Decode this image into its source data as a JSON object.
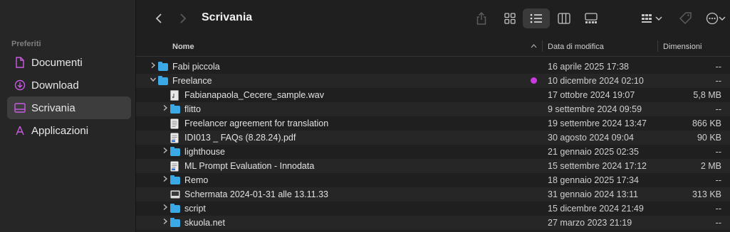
{
  "sidebar": {
    "header": "Preferiti",
    "items": [
      {
        "label": "Documenti",
        "icon": "document-icon",
        "selected": false
      },
      {
        "label": "Download",
        "icon": "download-icon",
        "selected": false
      },
      {
        "label": "Scrivania",
        "icon": "desktop-icon",
        "selected": true
      },
      {
        "label": "Applicazioni",
        "icon": "applications-icon",
        "selected": false
      }
    ]
  },
  "toolbar": {
    "title": "Scrivania",
    "active_view": "list"
  },
  "columns": {
    "name": "Nome",
    "date": "Data di modifica",
    "size": "Dimensioni"
  },
  "files": [
    {
      "name": "Fabi piccola",
      "date": "16 aprile 2025 17:38",
      "size": "--",
      "type": "folder",
      "level": 0,
      "expanded": false
    },
    {
      "name": "Freelance",
      "date": "10 dicembre 2024 02:10",
      "size": "--",
      "type": "folder",
      "level": 0,
      "expanded": true,
      "tag_color": "#c93bdf"
    },
    {
      "name": "Fabianapaola_Cecere_sample.wav",
      "date": "17 ottobre 2024 19:07",
      "size": "5,8 MB",
      "type": "audio",
      "level": 1
    },
    {
      "name": "flitto",
      "date": "9 settembre 2024 09:59",
      "size": "--",
      "type": "folder",
      "level": 1,
      "expanded": false
    },
    {
      "name": "Freelancer agreement for translation",
      "date": "19 settembre 2024 13:47",
      "size": "866 KB",
      "type": "document",
      "level": 1
    },
    {
      "name": "IDI013 _ FAQs (8.28.24).pdf",
      "date": "30 agosto 2024 09:04",
      "size": "90 KB",
      "type": "pdf",
      "level": 1
    },
    {
      "name": "lighthouse",
      "date": "21 gennaio 2025 02:35",
      "size": "--",
      "type": "folder",
      "level": 1,
      "expanded": false
    },
    {
      "name": "ML Prompt Evaluation - Innodata",
      "date": "15 settembre 2024 17:12",
      "size": "2 MB",
      "type": "pdf",
      "level": 1
    },
    {
      "name": "Remo",
      "date": "18 gennaio 2025 17:34",
      "size": "--",
      "type": "folder",
      "level": 1,
      "expanded": false
    },
    {
      "name": "Schermata 2024-01-31 alle 13.11.33",
      "date": "31 gennaio 2024 13:11",
      "size": "313 KB",
      "type": "image",
      "level": 1
    },
    {
      "name": "script",
      "date": "15 dicembre 2024 21:49",
      "size": "--",
      "type": "folder",
      "level": 1,
      "expanded": false
    },
    {
      "name": "skuola.net",
      "date": "27 marzo 2023 21:19",
      "size": "--",
      "type": "folder",
      "level": 1,
      "expanded": false
    }
  ]
}
